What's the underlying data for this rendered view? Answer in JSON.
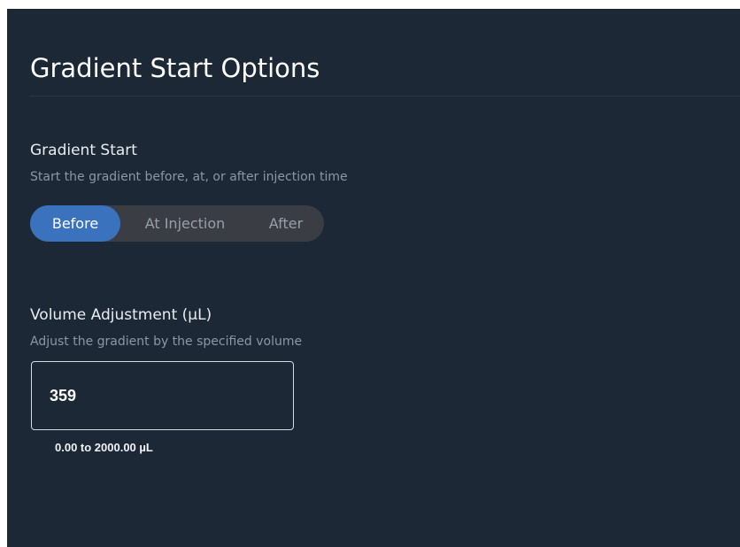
{
  "panel": {
    "title": "Gradient Start Options"
  },
  "gradient_start": {
    "label": "Gradient Start",
    "description": "Start the gradient before, at, or after injection time",
    "options": [
      "Before",
      "At Injection",
      "After"
    ],
    "selected": "Before"
  },
  "volume_adjustment": {
    "label": "Volume Adjustment (µL)",
    "description": "Adjust the gradient by the specified volume",
    "value": "359",
    "range_hint": "0.00 to 2000.00 µL"
  },
  "colors": {
    "panel_bg": "#1c2836",
    "accent": "#3a72be",
    "segment_bg": "#3a3e44"
  }
}
